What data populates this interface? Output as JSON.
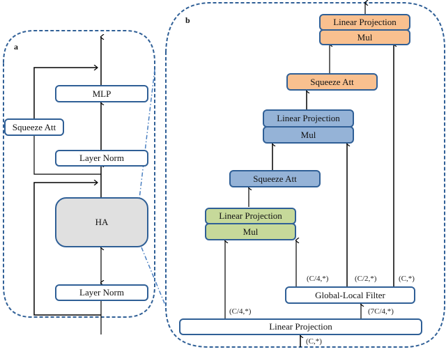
{
  "panel_a": {
    "label": "a",
    "boxes": {
      "mlp": "MLP",
      "squeeze_att": "Squeeze Att",
      "layer_norm_top": "Layer Norm",
      "ha": "HA",
      "layer_norm_bottom": "Layer Norm"
    }
  },
  "panel_b": {
    "label": "b",
    "orange_block": {
      "top": "Linear Projection",
      "bottom": "Mul"
    },
    "orange_squeeze": "Squeeze Att",
    "blue_block": {
      "top": "Linear Projection",
      "bottom": "Mul"
    },
    "blue_squeeze": "Squeeze Att",
    "green_block": {
      "top": "Linear Projection",
      "bottom": "Mul"
    },
    "global_local_filter": "Global-Local Filter",
    "linear_projection": "Linear Projection",
    "dims": {
      "input": "(C,*)",
      "lp_left": "(C/4,*)",
      "lp_right": "(7C/4,*)",
      "glf_1": "(C/4,*)",
      "glf_2": "(C/2,*)",
      "glf_3": "(C,*)"
    }
  },
  "colors": {
    "border": "#2f5f96",
    "orange": "#f9c08f",
    "blue": "#95b3d7",
    "green": "#c6d99a",
    "gray": "#e0e0e0"
  }
}
